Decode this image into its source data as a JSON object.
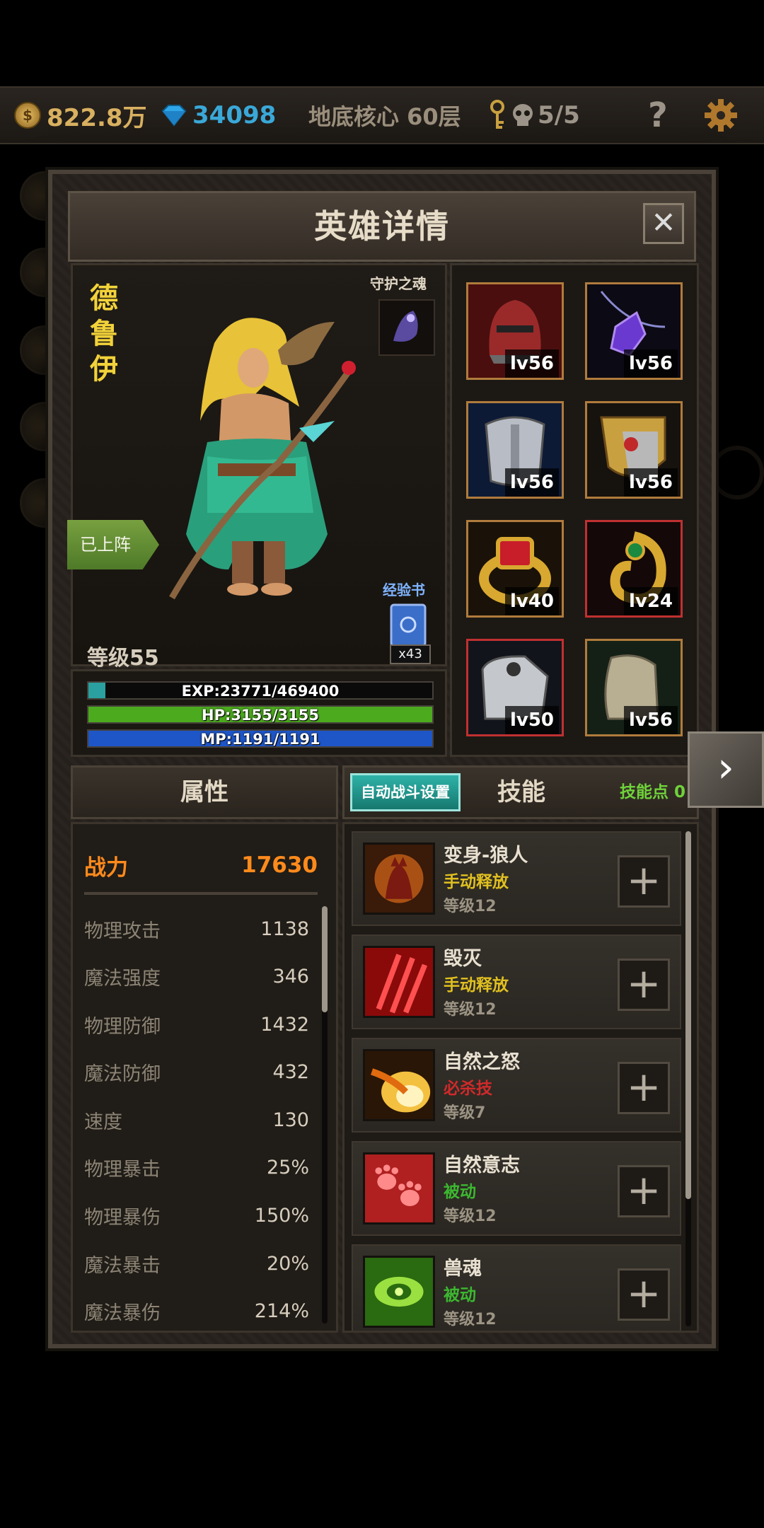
{
  "topbar": {
    "gold": "822.8万",
    "gems": "34098",
    "location": "地底核心 60层",
    "keys_icon": "key-icon",
    "skull_count": "5/5",
    "help": "?",
    "settings_icon": "gear-icon"
  },
  "dialog": {
    "title": "英雄详情",
    "close": "✕"
  },
  "hero": {
    "name": "德鲁伊",
    "status_tag": "已上阵",
    "guardian_soul_label": "守护之魂",
    "exp_book_label": "经验书",
    "exp_book_count": "x43",
    "level": "等级55"
  },
  "bars": {
    "exp": {
      "text": "EXP:23771/469400",
      "fraction": 0.05,
      "color": "#2aa0a0"
    },
    "hp": {
      "text": "HP:3155/3155",
      "fraction": 1.0,
      "color": "#4caa1e"
    },
    "mp": {
      "text": "MP:1191/1191",
      "fraction": 1.0,
      "color": "#1e56c8"
    }
  },
  "equipment": [
    {
      "name": "helmet",
      "level": "lv56",
      "border": "orange"
    },
    {
      "name": "amulet",
      "level": "lv56",
      "border": "orange"
    },
    {
      "name": "armor",
      "level": "lv56",
      "border": "orange"
    },
    {
      "name": "shoulder",
      "level": "lv56",
      "border": "orange"
    },
    {
      "name": "ring-ruby",
      "level": "lv40",
      "border": "orange"
    },
    {
      "name": "ring-emerald",
      "level": "lv24",
      "border": "red"
    },
    {
      "name": "gauntlet",
      "level": "lv50",
      "border": "red"
    },
    {
      "name": "boots",
      "level": "lv56",
      "border": "orange"
    }
  ],
  "attributes": {
    "header": "属性",
    "power_label": "战力",
    "power_value": "17630",
    "rows": [
      {
        "name": "物理攻击",
        "value": "1138"
      },
      {
        "name": "魔法强度",
        "value": "346"
      },
      {
        "name": "物理防御",
        "value": "1432"
      },
      {
        "name": "魔法防御",
        "value": "432"
      },
      {
        "name": "速度",
        "value": "130"
      },
      {
        "name": "物理暴击",
        "value": "25%"
      },
      {
        "name": "物理暴伤",
        "value": "150%"
      },
      {
        "name": "魔法暴击",
        "value": "20%"
      },
      {
        "name": "魔法暴伤",
        "value": "214%"
      }
    ]
  },
  "skills": {
    "auto_battle_button": "自动战斗设置",
    "tab_label": "技能",
    "skill_points": "技能点 0",
    "items": [
      {
        "name": "变身-狼人",
        "type": "手动释放",
        "type_color": "#e0c020",
        "level": "等级12"
      },
      {
        "name": "毁灭",
        "type": "手动释放",
        "type_color": "#e0c020",
        "level": "等级12"
      },
      {
        "name": "自然之怒",
        "type": "必杀技",
        "type_color": "#d02a2a",
        "level": "等级7"
      },
      {
        "name": "自然意志",
        "type": "被动",
        "type_color": "#3cb830",
        "level": "等级12"
      },
      {
        "name": "兽魂",
        "type": "被动",
        "type_color": "#3cb830",
        "level": "等级12"
      }
    ],
    "plus": "+"
  },
  "nav": {
    "next": "›"
  }
}
